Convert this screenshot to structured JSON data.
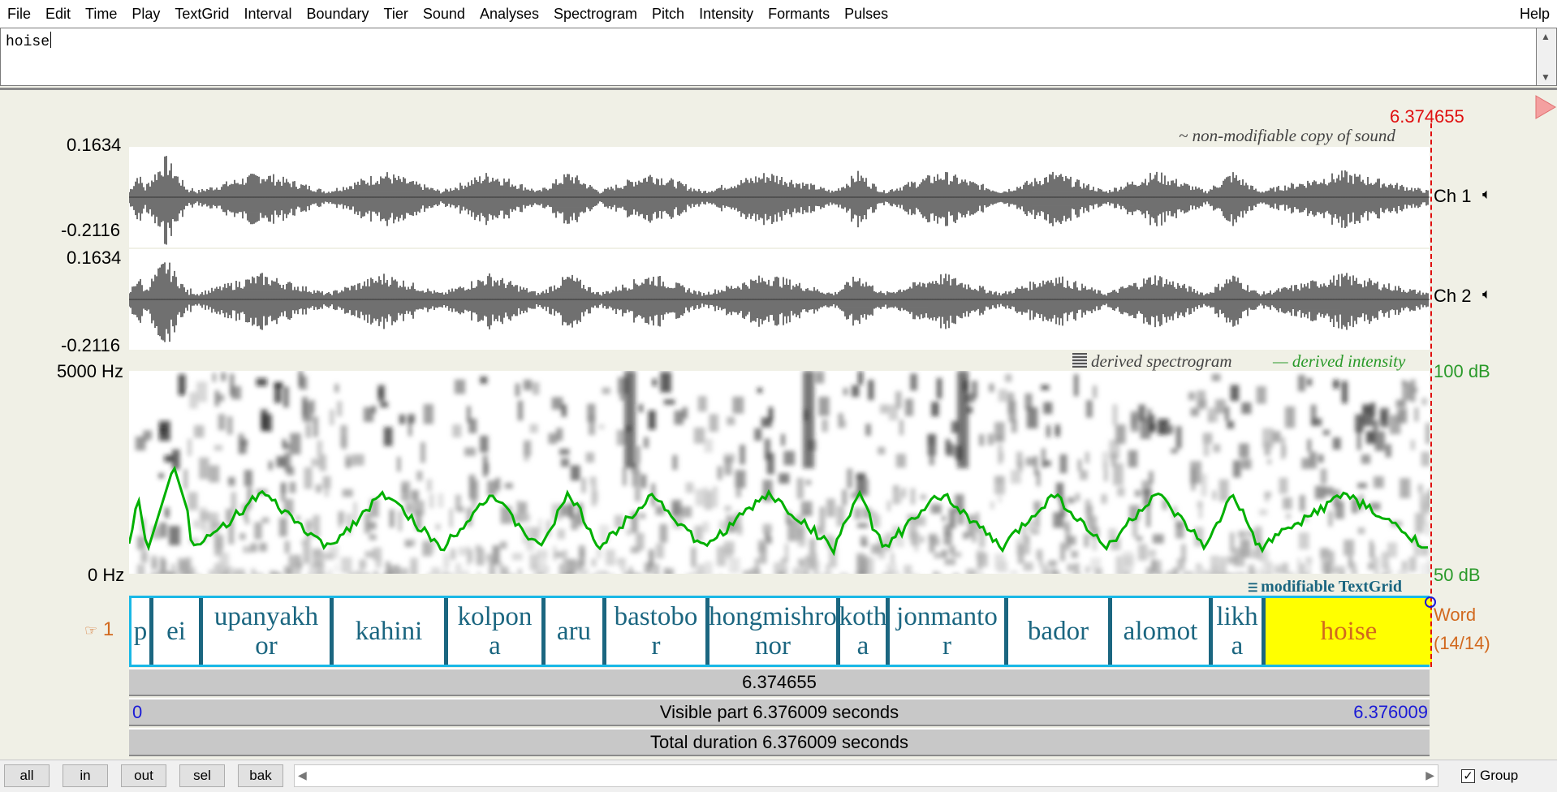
{
  "menu": {
    "items": [
      "File",
      "Edit",
      "Time",
      "Play",
      "TextGrid",
      "Interval",
      "Boundary",
      "Tier",
      "Sound",
      "Analyses",
      "Spectrogram",
      "Pitch",
      "Intensity",
      "Formants",
      "Pulses"
    ],
    "help": "Help"
  },
  "text_field": {
    "value": "hoise"
  },
  "cursor_time": "6.374655",
  "sound": {
    "header": "~ non-modifiable copy of sound",
    "channels": [
      {
        "label": "Ch 1",
        "ymax": "0.1634",
        "ymin": "-0.2116"
      },
      {
        "label": "Ch 2",
        "ymax": "0.1634",
        "ymin": "-0.2116"
      }
    ]
  },
  "spectrogram": {
    "header_spectro": "derived spectrogram",
    "header_intensity": "— derived intensity",
    "freq_max": "5000 Hz",
    "freq_min": "0 Hz",
    "intensity_max": "100 dB",
    "intensity_min": "50 dB"
  },
  "textgrid": {
    "header": "modifiable TextGrid",
    "tier_number": "1",
    "tier_name": "Word",
    "tier_count": "(14/14)",
    "intervals": [
      {
        "text": "p"
      },
      {
        "text": "ei"
      },
      {
        "text": "upanyakh\nor"
      },
      {
        "text": "kahini"
      },
      {
        "text": "kolpon\na"
      },
      {
        "text": "aru"
      },
      {
        "text": "bastobo\nr"
      },
      {
        "text": "hongmishro\nnor"
      },
      {
        "text": "koth\na"
      },
      {
        "text": "jonmanto\nr"
      },
      {
        "text": "bador"
      },
      {
        "text": "alomot"
      },
      {
        "text": "likh\na"
      },
      {
        "text": "hoise"
      }
    ]
  },
  "time_bars": {
    "cursor": "6.374655",
    "visible_start": "0",
    "visible": "Visible part 6.376009 seconds",
    "visible_end": "6.376009",
    "total": "Total duration 6.376009 seconds"
  },
  "buttons": {
    "all": "all",
    "in": "in",
    "out": "out",
    "sel": "sel",
    "bak": "bak"
  },
  "group": {
    "label": "Group",
    "checked": true
  },
  "colors": {
    "cursor": "#e01010",
    "intensity": "#00b000",
    "tier_border": "#1ab8e6",
    "selected_interval": "#ffff00",
    "time_blue": "#1a1ad6"
  }
}
